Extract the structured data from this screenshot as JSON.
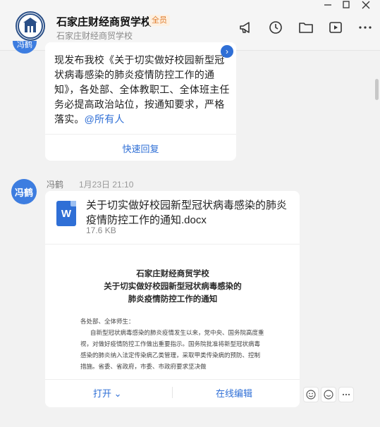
{
  "header": {
    "group_name": "石家庄财经商贸学校",
    "member_badge": "全员",
    "subtitle": "石家庄财经商贸学校"
  },
  "window_controls": [
    "minimize",
    "maximize",
    "close"
  ],
  "toolbar_icons": [
    "megaphone-icon",
    "history-icon",
    "folder-icon",
    "video-icon",
    "more-icon"
  ],
  "message1": {
    "body": "现发布我校《关于切实做好校园新型冠状病毒感染的肺炎疫情防控工作的通知》，各处部、全体教职工、全体班主任务必提高政治站位，按通知要求，严格落实。",
    "mention": "@所有人",
    "quick_reply": "快速回复",
    "avatar_text": "冯鹤"
  },
  "message2": {
    "avatar_text": "冯鹤",
    "sender": "冯鹤",
    "time": "1月23日 21:10",
    "file": {
      "icon_letter": "W",
      "name": "关于切实做好校园新型冠状病毒感染的肺炎疫情防控工作的通知.docx",
      "size": "17.6 KB"
    },
    "preview": {
      "title_line1": "石家庄财经商贸学校",
      "title_line2": "关于切实做好校园新型冠状病毒感染的",
      "title_line3": "肺炎疫情防控工作的通知",
      "salutation": "各处部、全体师生：",
      "paragraph": "自新型冠状病毒感染的肺炎疫情发生以来，党中央、国务院高度重视，对做好疫情防控工作做出重要指示。国务院批准将新型冠状病毒感染的肺炎纳入法定传染病乙类管理，采取甲类传染病的预防、控制措施。省委、省政府，市委、市政府要求坚决做"
    },
    "actions": {
      "open": "打开 ⌄",
      "edit": "在线编辑"
    }
  },
  "reactions": [
    "emoji-icon",
    "sticker-icon",
    "more-icon"
  ]
}
